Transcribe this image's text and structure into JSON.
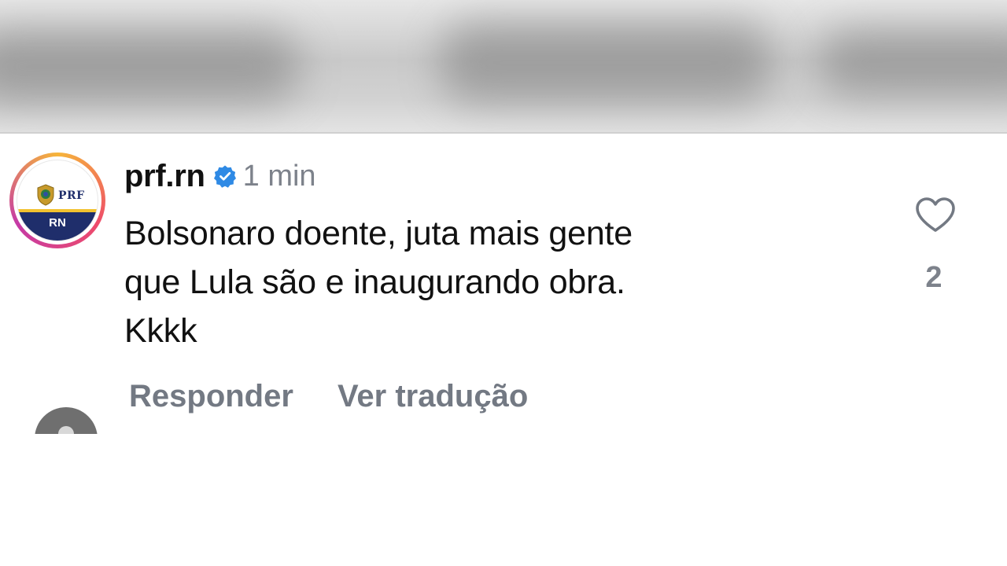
{
  "comment": {
    "username": "prf.rn",
    "timestamp": "1 min",
    "text_lines": [
      "Bolsonaro doente, juta mais gente",
      "que Lula são e inaugurando obra.",
      "Kkkk"
    ],
    "like_count": "2",
    "actions": {
      "reply_label": "Responder",
      "translate_label": "Ver tradução"
    },
    "avatar": {
      "top_text": "PRF",
      "bottom_text": "RN"
    }
  },
  "icons": {
    "verified": "verified-badge-icon",
    "like": "heart-outline-icon"
  },
  "colors": {
    "verified_blue": "#2f8ae5",
    "secondary_text": "#7d828b",
    "avatar_navy": "#1f2e6b",
    "avatar_gold": "#f2c230"
  }
}
